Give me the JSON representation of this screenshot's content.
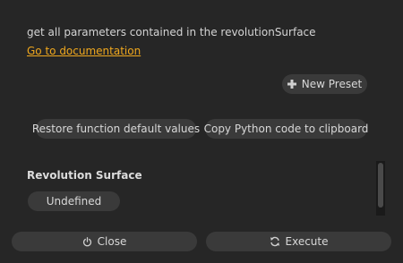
{
  "description": "get all parameters contained in the revolutionSurface",
  "documentation_link": "Go to documentation",
  "presets": {
    "new_preset_label": "New Preset"
  },
  "actions": {
    "restore_label": "Restore function default values",
    "copy_label": "Copy Python code to clipboard"
  },
  "parameters": {
    "section_title": "Revolution Surface",
    "value_label": "Undefined"
  },
  "footer": {
    "close_label": "Close",
    "execute_label": "Execute"
  },
  "icons": {
    "new_preset": "plus-icon",
    "close": "power-icon",
    "execute": "refresh-icon"
  },
  "colors": {
    "background": "#262626",
    "button": "#3a3a3a",
    "link": "#f0a81e",
    "text": "#d6d6d6"
  }
}
